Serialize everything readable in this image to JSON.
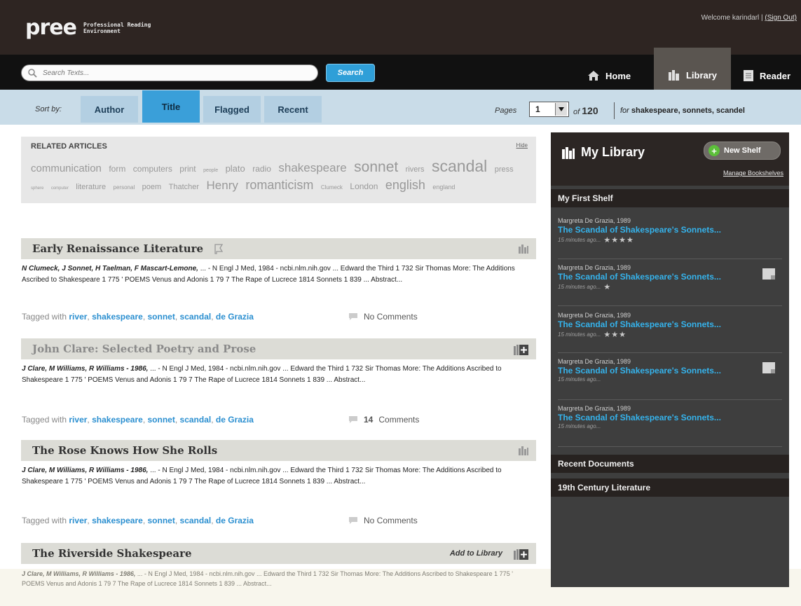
{
  "header": {
    "logo_text": "pree",
    "logo_tag_line1": "Professional Reading",
    "logo_tag_line2": "Environment",
    "welcome": "Welcome karindarl",
    "separator": "|",
    "sign_out": "(Sign Out)"
  },
  "search": {
    "placeholder": "Search Texts...",
    "button": "Search"
  },
  "nav": {
    "home": "Home",
    "library": "Library",
    "reader": "Reader"
  },
  "sortbar": {
    "label": "Sort by:",
    "tabs": [
      "Author",
      "Title",
      "Flagged",
      "Recent"
    ],
    "pages_label": "Pages",
    "page_value": "1",
    "of_label": "of",
    "total_pages": "120",
    "query_prefix": "for",
    "query_terms": "shakespeare, sonnets, scandel"
  },
  "related": {
    "title": "RELATED ARTICLES",
    "hide": "Hide",
    "tags": [
      {
        "text": "communication",
        "size": 15
      },
      {
        "text": "form",
        "size": 12
      },
      {
        "text": "computers",
        "size": 12
      },
      {
        "text": "print",
        "size": 12
      },
      {
        "text": "people",
        "size": 7
      },
      {
        "text": "plato",
        "size": 13
      },
      {
        "text": "radio",
        "size": 12
      },
      {
        "text": "shakespeare",
        "size": 17
      },
      {
        "text": "sonnet",
        "size": 21
      },
      {
        "text": "rivers",
        "size": 11
      },
      {
        "text": "scandal",
        "size": 23
      },
      {
        "text": "press",
        "size": 11
      },
      {
        "text": "sphere",
        "size": 6
      },
      {
        "text": "computer",
        "size": 6
      },
      {
        "text": "literature",
        "size": 11
      },
      {
        "text": "personal",
        "size": 8
      },
      {
        "text": "poem",
        "size": 11
      },
      {
        "text": "Thatcher",
        "size": 11
      },
      {
        "text": "Henry",
        "size": 17
      },
      {
        "text": "romanticism",
        "size": 18
      },
      {
        "text": "Clumeck",
        "size": 8
      },
      {
        "text": "London",
        "size": 12
      },
      {
        "text": "english",
        "size": 18
      },
      {
        "text": "england",
        "size": 9
      }
    ]
  },
  "articles": [
    {
      "title": "Early Renaissance Literature",
      "authors": "N Clumeck, J Sonnet, H Taelman, F Mascart-Lemone,",
      "snippet": " ... - N Engl J Med, 1984 - ncbi.nlm.nih.gov ... Edward the Third 1 732 Sir Thomas More: The Additions Ascribed to Shakespeare 1 775 ' POEMS Venus and Adonis 1 79 7 The Rape of Lucrece 1814 Sonnets 1 839 ... Abstract...",
      "tagged_with": "Tagged with",
      "tags": [
        "river",
        "shakespeare",
        "sonnet",
        "scandal",
        "de Grazia"
      ],
      "comments": "No Comments"
    },
    {
      "title": "John Clare: Selected Poetry and Prose",
      "authors": "J Clare, M Williams, R Williams - 1986,",
      "snippet": " ... - N Engl J Med, 1984 - ncbi.nlm.nih.gov ... Edward the Third 1 732 Sir Thomas More: The Additions Ascribed to Shakespeare 1 775 ' POEMS Venus and Adonis 1 79 7 The Rape of Lucrece 1814 Sonnets 1 839 ... Abstract...",
      "tagged_with": "Tagged with",
      "tags": [
        "river",
        "shakespeare",
        "sonnet",
        "scandal",
        "de Grazia"
      ],
      "comments_count": "14",
      "comments": "Comments"
    },
    {
      "title": "The Rose Knows How She Rolls",
      "authors": "J Clare, M Williams, R Williams - 1986,",
      "snippet": " ... - N Engl J Med, 1984 - ncbi.nlm.nih.gov ... Edward the Third 1 732 Sir Thomas More: The Additions Ascribed to Shakespeare 1 775 ' POEMS Venus and Adonis 1 79 7 The Rape of Lucrece 1814 Sonnets 1 839 ... Abstract...",
      "tagged_with": "Tagged with",
      "tags": [
        "river",
        "shakespeare",
        "sonnet",
        "scandal",
        "de Grazia"
      ],
      "comments": "No Comments"
    },
    {
      "title": "The Riverside Shakespeare",
      "add_to_library": "Add to Library",
      "authors": "J Clare, M Williams, R Williams - 1986,",
      "snippet": " ... - N Engl J Med, 1984 - ncbi.nlm.nih.gov ... Edward the Third 1 732 Sir Thomas More: The Additions Ascribed to Shakespeare 1 775 ' POEMS Venus and Adonis 1 79 7 The Rape of Lucrece 1814 Sonnets 1 839 ... Abstract..."
    }
  ],
  "sidebar": {
    "title": "My Library",
    "new_shelf": "New Shelf",
    "manage": "Manage Bookshelves",
    "shelf_name": "My First Shelf",
    "books": [
      {
        "author": "Margreta De Grazia, 1989",
        "title": "The Scandal of Shakespeare's Sonnets...",
        "time": "15 minutes ago...",
        "stars": "★★★★",
        "note": false
      },
      {
        "author": "Margreta De Grazia, 1989",
        "title": "The Scandal of Shakespeare's Sonnets...",
        "time": "15 minutes ago...",
        "stars": "★",
        "note": true
      },
      {
        "author": "Margreta De Grazia, 1989",
        "title": "The Scandal of Shakespeare's Sonnets...",
        "time": "15 minutes ago...",
        "stars": "★★★",
        "note": false
      },
      {
        "author": "Margreta De Grazia, 1989",
        "title": "The Scandal of Shakespeare's Sonnets...",
        "time": "15 minutes ago...",
        "stars": "",
        "note": true
      },
      {
        "author": "Margreta De Grazia, 1989",
        "title": "The Scandal of Shakespeare's Sonnets...",
        "time": "15 minutes ago...",
        "stars": "",
        "note": false
      }
    ],
    "recent": "Recent Documents",
    "century": "19th Century Literature"
  },
  "colors": {
    "header_bg": "#2e2522",
    "nav_bg": "#111111",
    "sortbar_bg": "#c9dce8",
    "accent_blue": "#2f9fd8",
    "tag_link": "#2b8fd0",
    "sidebar_link": "#35b3ec",
    "new_shelf_plus": "#5cbf3a"
  }
}
